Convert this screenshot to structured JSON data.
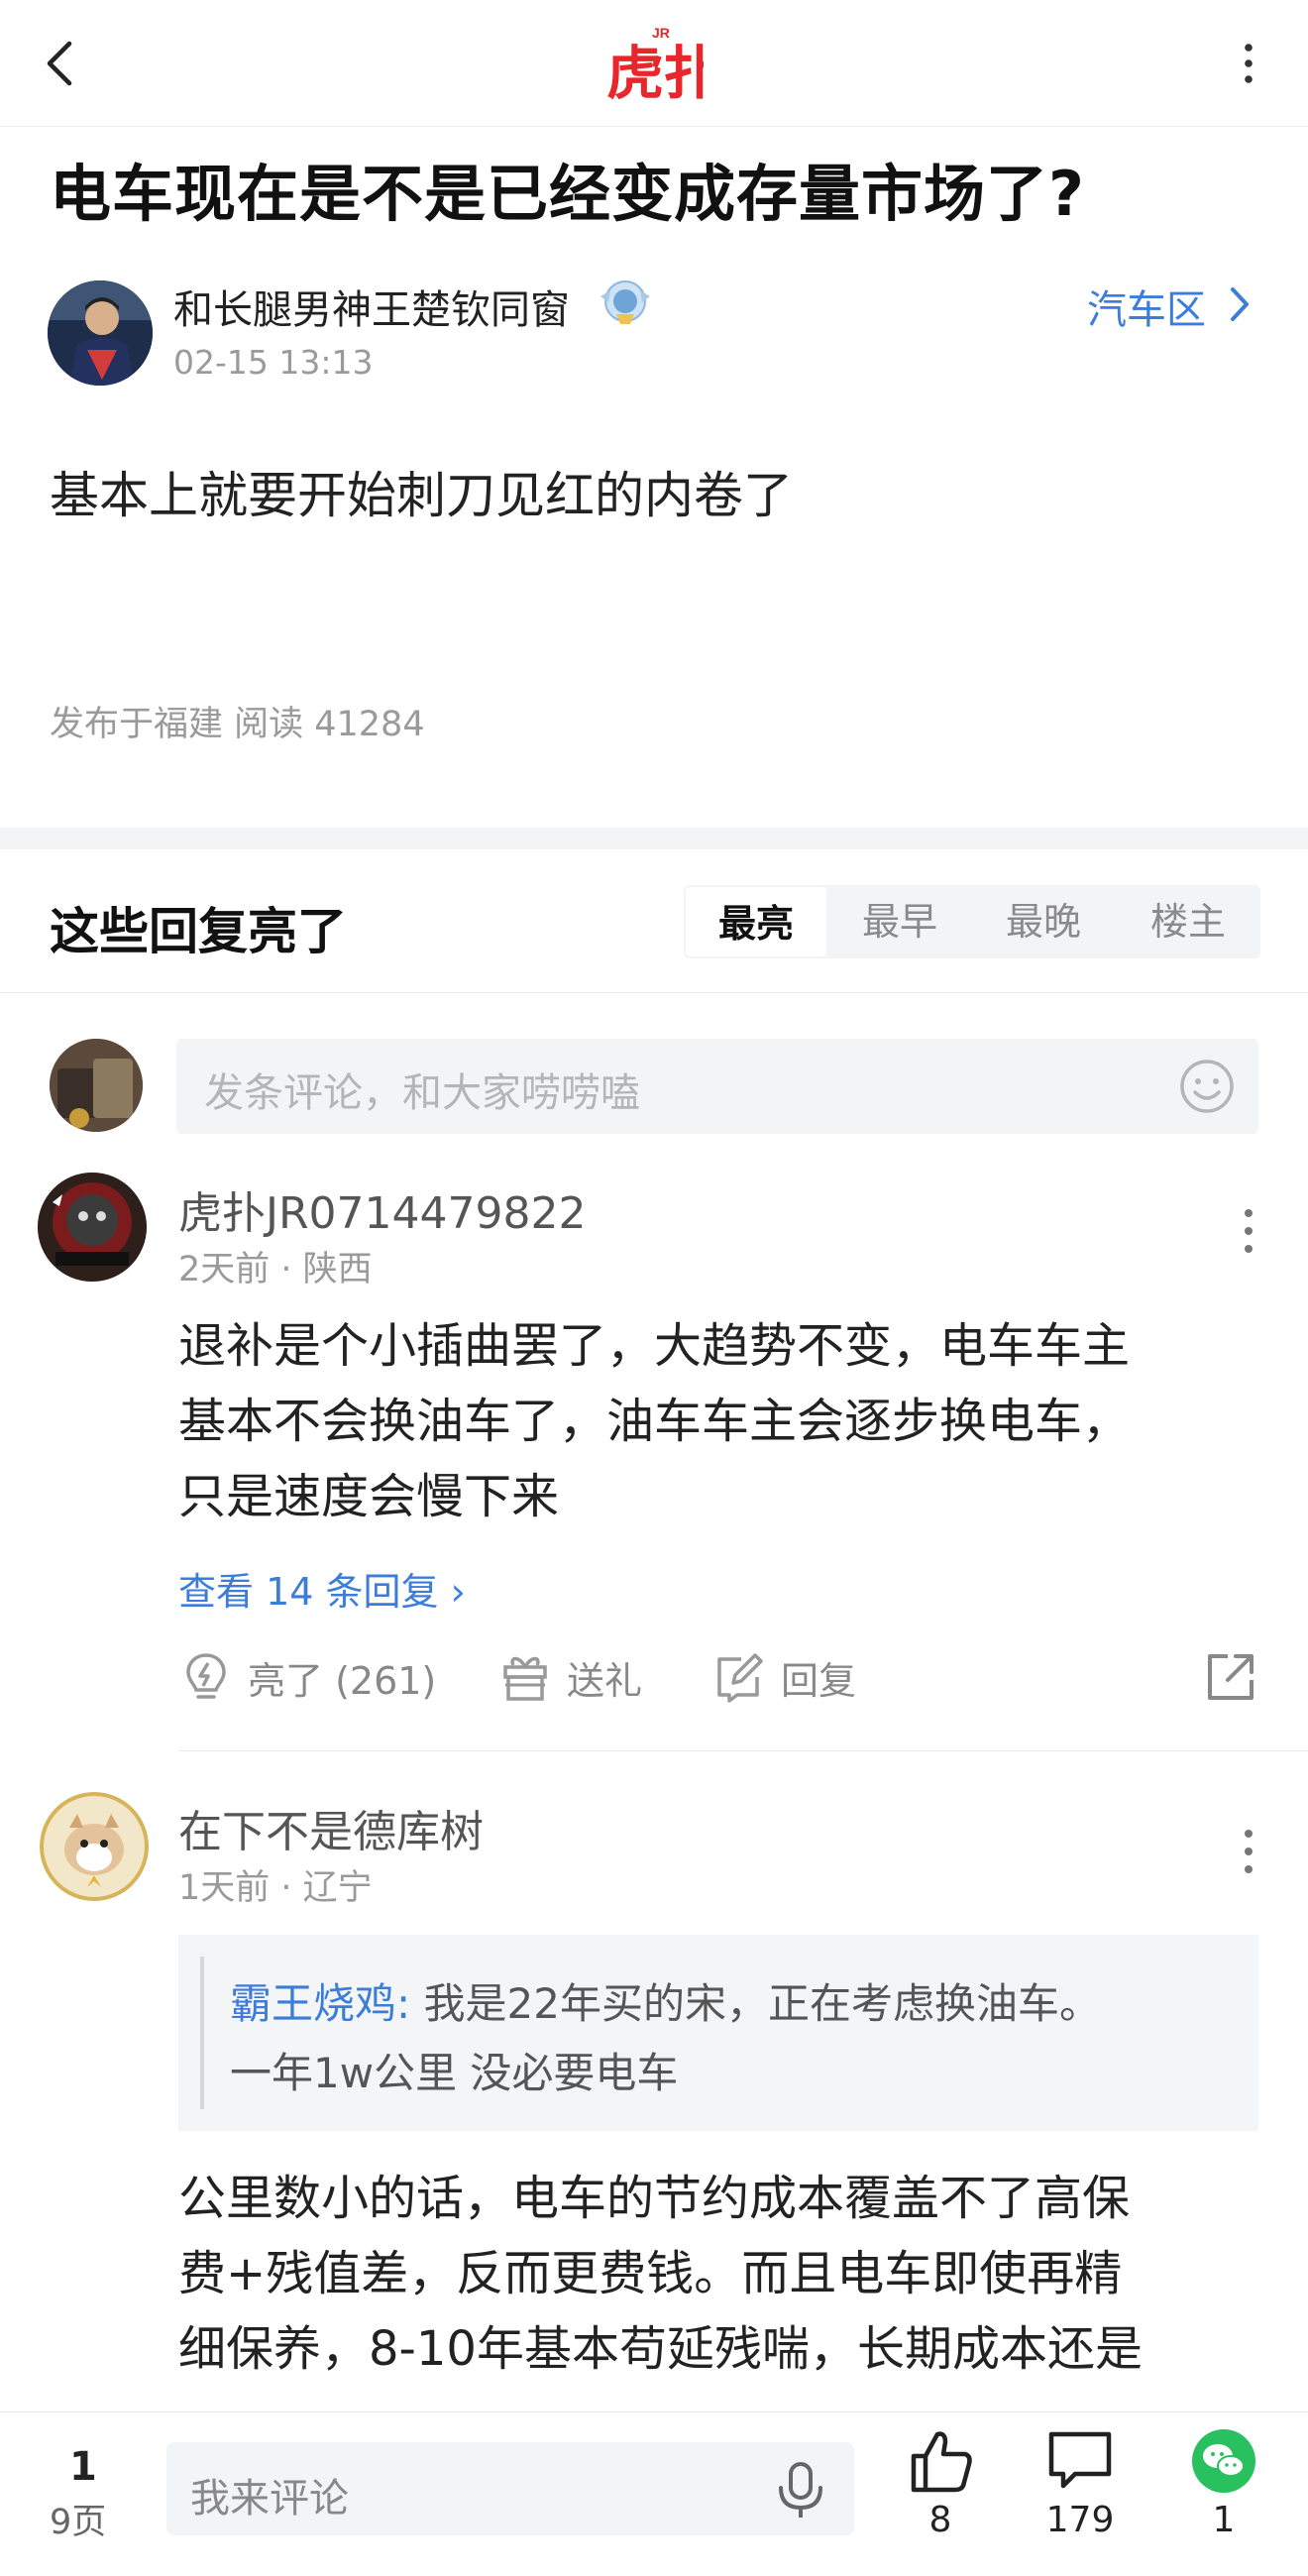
{
  "topbar": {
    "logo_text": "虎扑",
    "logo_sup": "JR"
  },
  "post": {
    "title": "电车现在是不是已经变成存量市场了?",
    "author": "和长腿男神王楚钦同窗",
    "time": "02-15 13:13",
    "section": "汽车区",
    "body": "基本上就要开始刺刀见红的内卷了",
    "meta": "发布于福建  阅读 41284"
  },
  "replies_header": {
    "title": "这些回复亮了",
    "tabs": [
      "最亮",
      "最早",
      "最晚",
      "楼主"
    ],
    "active_tab": 0
  },
  "comment_input": {
    "placeholder": "发条评论，和大家唠唠嗑"
  },
  "comments": [
    {
      "name": "虎扑JR0714479822",
      "meta": "2天前 · 陕西",
      "lines": [
        "退补是个小插曲罢了，大趋势不变，电车车主",
        "基本不会换油车了，油车车主会逐步换电车，",
        "只是速度会慢下来"
      ],
      "view_replies": "查看 14 条回复 ›",
      "actions": {
        "like": "亮了 (261)",
        "gift": "送礼",
        "reply": "回复"
      }
    },
    {
      "name": "在下不是德库树",
      "meta": "1天前 · 辽宁",
      "quote": {
        "author": "霸王烧鸡:",
        "line1": " 我是22年买的宋，正在考虑换油车。",
        "line2": "一年1w公里 没必要电车"
      },
      "lines": [
        "公里数小的话，电车的节约成本覆盖不了高保",
        "费+残值差，反而更费钱。而且电车即使再精",
        "细保养，8-10年基本苟延残喘，长期成本还是"
      ]
    }
  ],
  "bottombar": {
    "page": "1",
    "pages": "9页",
    "placeholder": "我来评论",
    "likes": "8",
    "comments": "179",
    "shares": "1"
  },
  "colors": {
    "link": "#3b7dd8",
    "brand_red": "#e8262b",
    "wechat_green": "#29c160"
  }
}
